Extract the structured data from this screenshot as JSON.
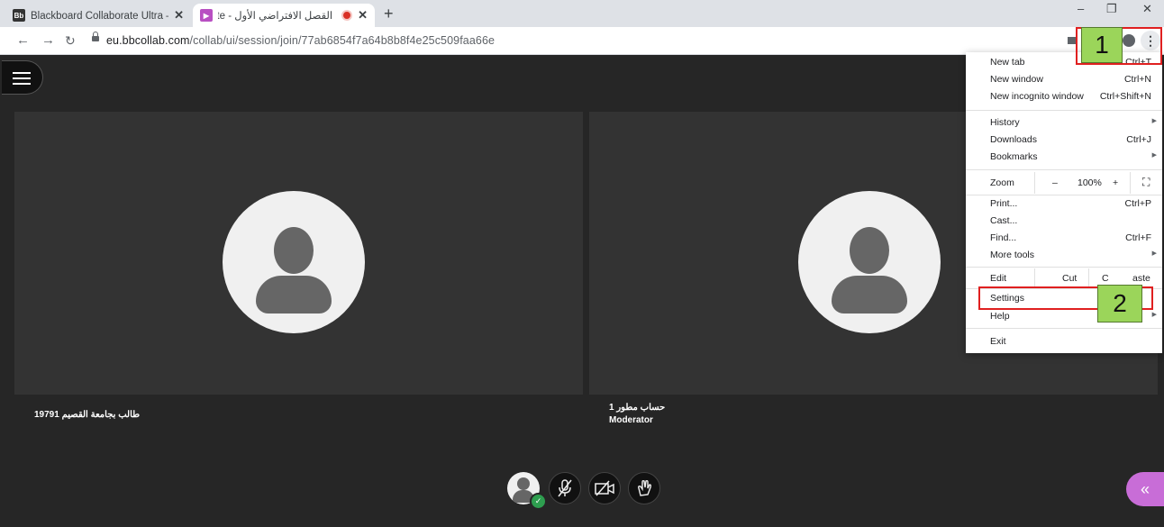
{
  "browser": {
    "tabs": [
      {
        "title": "Blackboard Collaborate Ultra – ‫بـ",
        "favicon": "Bb",
        "active": false
      },
      {
        "title": "القصل الافتراضي الأول - ‪orate",
        "favicon": "collab",
        "active": true
      }
    ],
    "url_host": "eu.bbcollab.com",
    "url_path": "/collab/ui/session/join/77ab6854f7a64b8b8f4e25c509faa66e"
  },
  "session": {
    "participants": [
      {
        "name": "19791 طالب بجامعة القصيم",
        "role": ""
      },
      {
        "name": "حساب مطور 1",
        "role": "Moderator"
      }
    ]
  },
  "chrome_menu": {
    "new_tab": {
      "label": "New tab",
      "shortcut": "Ctrl+T"
    },
    "new_window": {
      "label": "New window",
      "shortcut": "Ctrl+N"
    },
    "new_incognito": {
      "label": "New incognito window",
      "shortcut": "Ctrl+Shift+N"
    },
    "history": {
      "label": "History"
    },
    "downloads": {
      "label": "Downloads",
      "shortcut": "Ctrl+J"
    },
    "bookmarks": {
      "label": "Bookmarks"
    },
    "zoom": {
      "label": "Zoom",
      "minus": "–",
      "value": "100%",
      "plus": "+"
    },
    "print": {
      "label": "Print...",
      "shortcut": "Ctrl+P"
    },
    "cast": {
      "label": "Cast..."
    },
    "find": {
      "label": "Find...",
      "shortcut": "Ctrl+F"
    },
    "more_tools": {
      "label": "More tools"
    },
    "edit": {
      "label": "Edit",
      "cut": "Cut",
      "copy": "C",
      "paste": "aste"
    },
    "settings": {
      "label": "Settings"
    },
    "help": {
      "label": "Help"
    },
    "exit": {
      "label": "Exit"
    }
  },
  "annotations": {
    "badge1": "1",
    "badge2": "2",
    "highlight_color": "#e02020",
    "badge_color": "#9bd55a"
  },
  "icons": [
    "menu-icon",
    "mic-off-icon",
    "camera-off-icon",
    "raise-hand-icon",
    "chevron-double-left-icon",
    "kebab-menu-icon"
  ]
}
